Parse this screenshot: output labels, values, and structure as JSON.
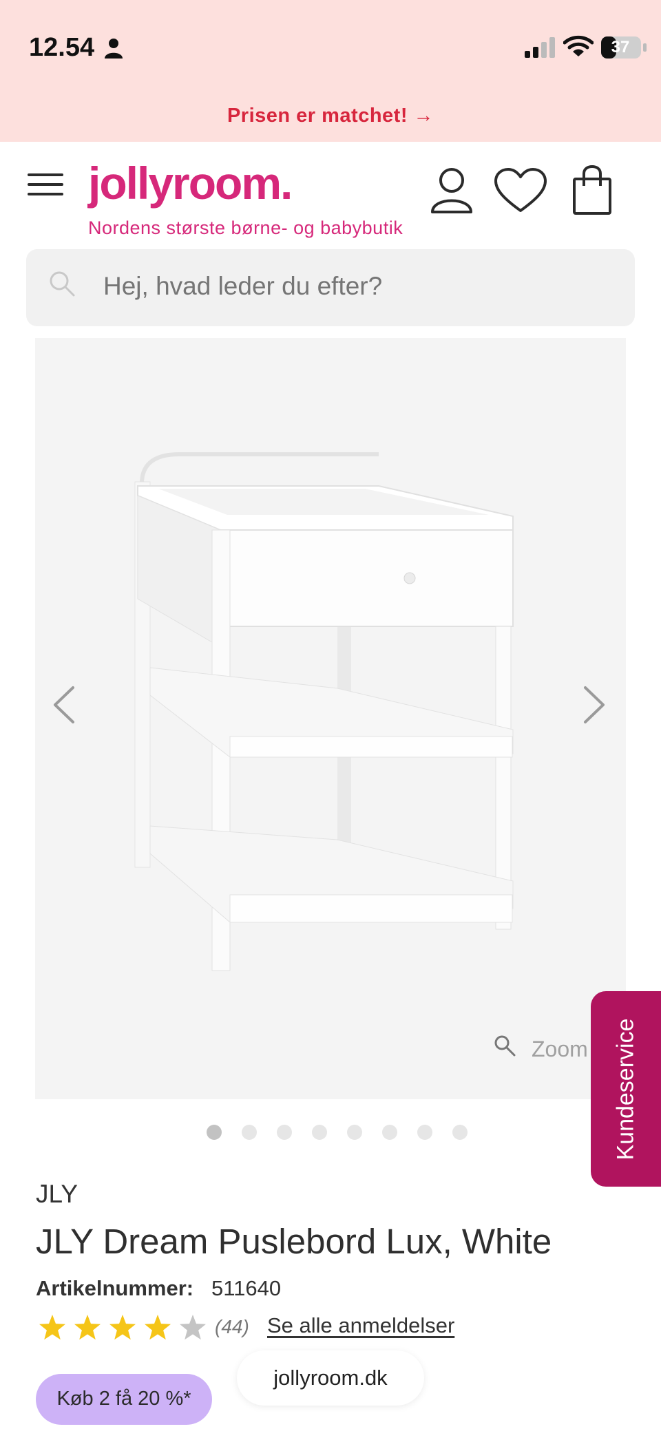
{
  "status_bar": {
    "time": "12.54",
    "battery": "37"
  },
  "promo": {
    "text": "Prisen er matchet! →"
  },
  "header": {
    "logo": "jollyroom.",
    "tagline": "Nordens største børne- og babybutik"
  },
  "search": {
    "placeholder": "Hej, hvad leder du efter?"
  },
  "gallery": {
    "zoom_label": "Zoom",
    "total_images": 8,
    "active_index": 0
  },
  "support": {
    "label": "Kundeservice"
  },
  "product": {
    "brand": "JLY",
    "title": "JLY Dream Puslebord Lux, White",
    "sku_label": "Artikelnummer:",
    "sku_value": "511640",
    "rating": 4,
    "rating_max": 5,
    "review_count": "(44)",
    "reviews_link": "Se alle anmeldelser",
    "offer": "Køb 2 få 20 %*"
  },
  "browser": {
    "url": "jollyroom.dk"
  },
  "colors": {
    "brand_pink": "#d6287a",
    "promo_red": "#d7263d",
    "support_magenta": "#b0145e",
    "offer_lilac": "#cdb2f7",
    "star_gold": "#f5c518"
  }
}
